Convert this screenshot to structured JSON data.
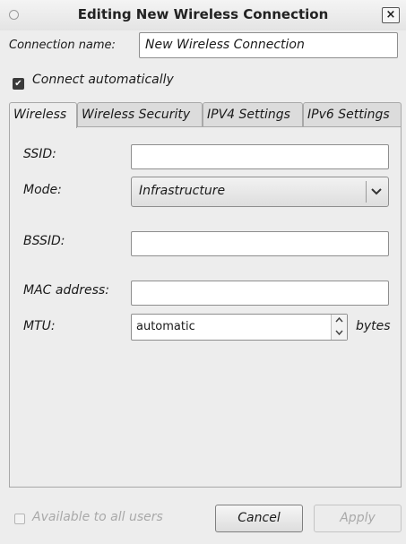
{
  "window": {
    "title": "Editing New Wireless Connection",
    "close_glyph": "×"
  },
  "connection": {
    "name_label": "Connection name:",
    "name_value": "New Wireless Connection",
    "connect_auto_label": "Connect automatically",
    "connect_auto_checked": true
  },
  "tabs": [
    {
      "label": "Wireless",
      "active": true
    },
    {
      "label": "Wireless Security",
      "active": false
    },
    {
      "label": "IPV4 Settings",
      "active": false
    },
    {
      "label": "IPv6 Settings",
      "active": false
    }
  ],
  "wireless": {
    "ssid_label": "SSID:",
    "ssid_value": "",
    "mode_label": "Mode:",
    "mode_value": "Infrastructure",
    "bssid_label": "BSSID:",
    "bssid_value": "",
    "mac_label": "MAC address:",
    "mac_value": "",
    "mtu_label": "MTU:",
    "mtu_value": "automatic",
    "mtu_unit": "bytes"
  },
  "footer": {
    "all_users_label": "Available to all users",
    "all_users_checked": false,
    "cancel_label": "Cancel",
    "apply_label": "Apply"
  },
  "icons": {
    "window_menu": "window-menu-icon",
    "close": "close-icon",
    "checkbox": "checkmark-icon",
    "dropdown": "chevron-down-icon",
    "spin": "spin-arrows-icon"
  }
}
